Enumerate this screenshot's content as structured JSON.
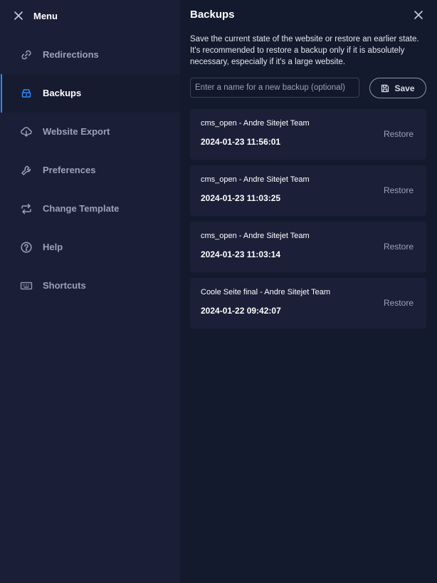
{
  "sidebar": {
    "title": "Menu",
    "items": [
      {
        "label": "Redirections",
        "icon": "link-icon",
        "active": false
      },
      {
        "label": "Backups",
        "icon": "backup-icon",
        "active": true
      },
      {
        "label": "Website Export",
        "icon": "cloud-download-icon",
        "active": false
      },
      {
        "label": "Preferences",
        "icon": "wrench-icon",
        "active": false
      },
      {
        "label": "Change Template",
        "icon": "swap-icon",
        "active": false
      },
      {
        "label": "Help",
        "icon": "help-icon",
        "active": false
      },
      {
        "label": "Shortcuts",
        "icon": "keyboard-icon",
        "active": false
      }
    ]
  },
  "main": {
    "title": "Backups",
    "description": "Save the current state of the website or restore an earlier state. It's recommended to restore a backup only if it is absolutely necessary, especially if it's a large website.",
    "input_placeholder": "Enter a name for a new backup (optional)",
    "save_label": "Save",
    "backups": [
      {
        "name": "cms_open - Andre Sitejet Team",
        "date": "2024-01-23 11:56:01",
        "action": "Restore"
      },
      {
        "name": "cms_open - Andre Sitejet Team",
        "date": "2024-01-23 11:03:25",
        "action": "Restore"
      },
      {
        "name": "cms_open - Andre Sitejet Team",
        "date": "2024-01-23 11:03:14",
        "action": "Restore"
      },
      {
        "name": "Coole Seite final - Andre Sitejet Team",
        "date": "2024-01-22 09:42:07",
        "action": "Restore"
      }
    ]
  },
  "colors": {
    "accent": "#2f8cff",
    "sidebar_bg": "#1a1f37",
    "main_bg": "#141a2d",
    "card_bg": "#1b2038"
  }
}
